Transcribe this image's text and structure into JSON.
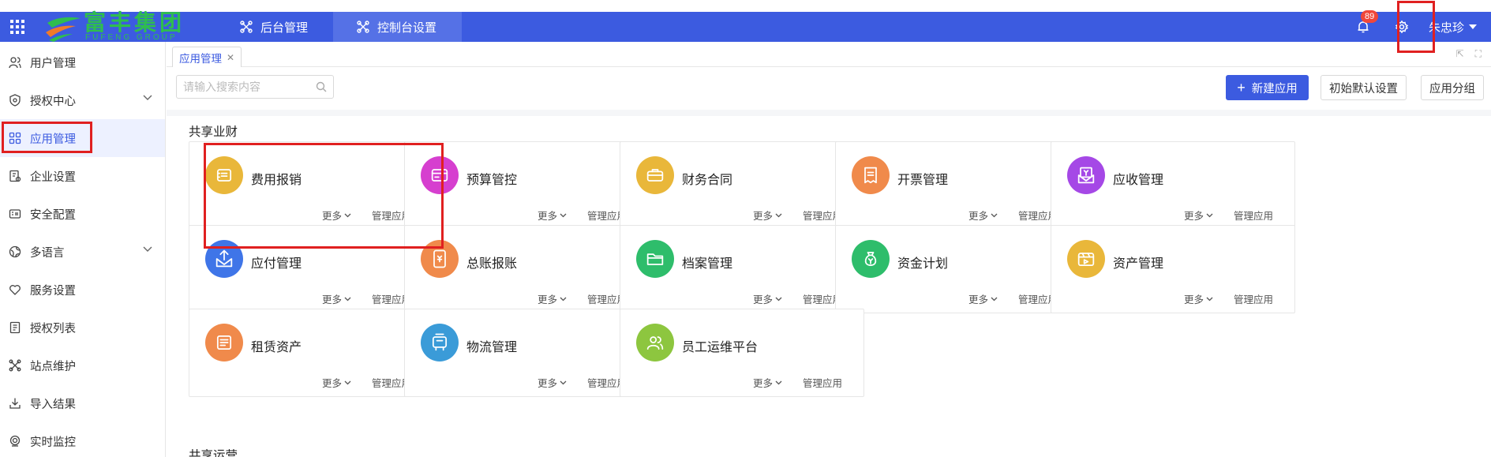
{
  "header": {
    "logo_main": "富丰集团",
    "logo_sub": "FUFENG GROUP",
    "tabs": [
      {
        "label": "后台管理",
        "active": false
      },
      {
        "label": "控制台设置",
        "active": true
      }
    ],
    "notification_count": "89",
    "user_name": "朱忠珍"
  },
  "sidebar": {
    "items": [
      {
        "label": "用户管理",
        "icon": "user-icon",
        "expandable": false
      },
      {
        "label": "授权中心",
        "icon": "shield-icon",
        "expandable": true
      },
      {
        "label": "应用管理",
        "icon": "apps-icon",
        "expandable": false,
        "active": true
      },
      {
        "label": "企业设置",
        "icon": "building-doc-icon",
        "expandable": false
      },
      {
        "label": "安全配置",
        "icon": "security-icon",
        "expandable": false
      },
      {
        "label": "多语言",
        "icon": "globe-icon",
        "expandable": true
      },
      {
        "label": "服务设置",
        "icon": "heart-icon",
        "expandable": false
      },
      {
        "label": "授权列表",
        "icon": "list-icon",
        "expandable": false
      },
      {
        "label": "站点维护",
        "icon": "tools-icon",
        "expandable": false
      },
      {
        "label": "导入结果",
        "icon": "import-icon",
        "expandable": false
      },
      {
        "label": "实时监控",
        "icon": "monitor-icon",
        "expandable": false
      }
    ]
  },
  "page_tab": {
    "label": "应用管理"
  },
  "toolbar": {
    "search_placeholder": "请输入搜索内容",
    "new_app": "新建应用",
    "reset_default": "初始默认设置",
    "app_group": "应用分组"
  },
  "section": {
    "title": "共享业财",
    "next_title": "共享运营",
    "more_label": "更多",
    "manage_label": "管理应用",
    "apps": [
      {
        "name": "费用报销",
        "color": "#e9b73a",
        "icon": "expense-icon"
      },
      {
        "name": "预算管控",
        "color": "#d63fcf",
        "icon": "budget-icon"
      },
      {
        "name": "财务合同",
        "color": "#e9b73a",
        "icon": "contract-icon"
      },
      {
        "name": "开票管理",
        "color": "#f08a4b",
        "icon": "invoice-icon"
      },
      {
        "name": "应收管理",
        "color": "#a548e6",
        "icon": "receivable-icon"
      },
      {
        "name": "应付管理",
        "color": "#3f75e8",
        "icon": "payable-icon"
      },
      {
        "name": "总账报账",
        "color": "#f08a4b",
        "icon": "ledger-icon"
      },
      {
        "name": "档案管理",
        "color": "#2ebd6b",
        "icon": "folder-icon"
      },
      {
        "name": "资金计划",
        "color": "#2ebd6b",
        "icon": "money-bag-icon"
      },
      {
        "name": "资产管理",
        "color": "#e9b73a",
        "icon": "asset-icon"
      },
      {
        "name": "租赁资产",
        "color": "#f08a4b",
        "icon": "lease-icon"
      },
      {
        "name": "物流管理",
        "color": "#3a9bd8",
        "icon": "logistics-icon"
      },
      {
        "name": "员工运维平台",
        "color": "#8dc63f",
        "icon": "staff-icon"
      }
    ]
  }
}
